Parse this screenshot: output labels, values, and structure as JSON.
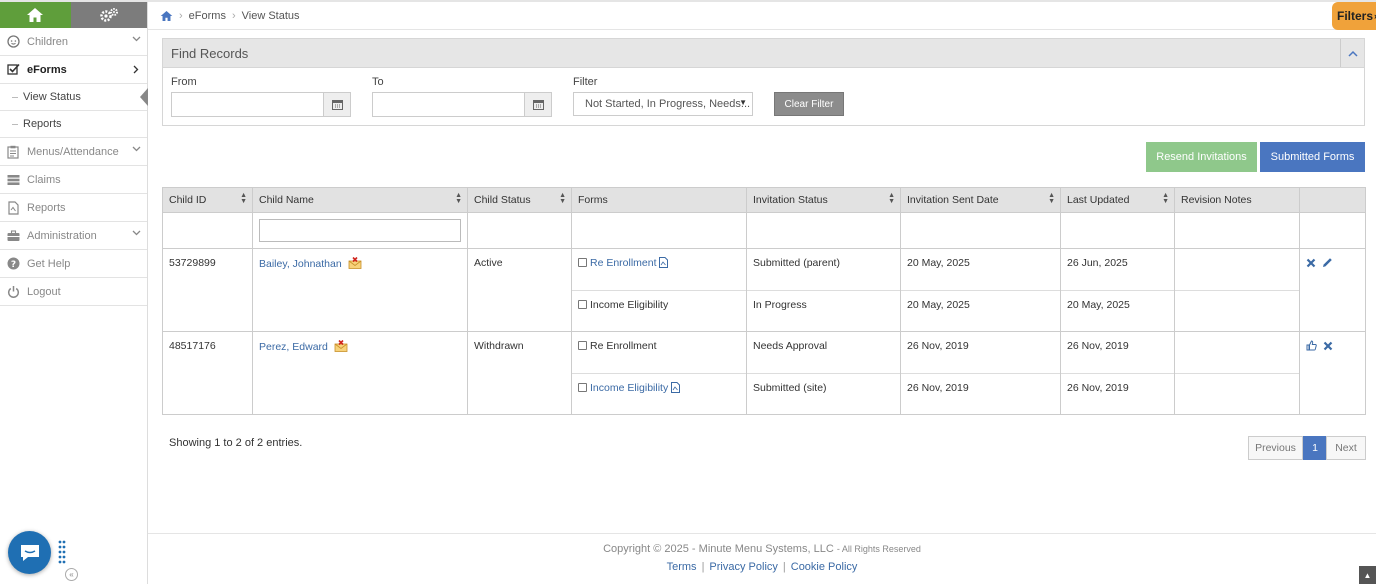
{
  "sidebar": {
    "items": [
      {
        "label": "Children",
        "icon": "child-face-icon"
      },
      {
        "label": "eForms",
        "icon": "checkbox-icon"
      },
      {
        "label": "View Status"
      },
      {
        "label": "Reports"
      },
      {
        "label": "Menus/Attendance",
        "icon": "clipboard-icon"
      },
      {
        "label": "Claims",
        "icon": "claims-icon"
      },
      {
        "label": "Reports",
        "icon": "report-file-icon"
      },
      {
        "label": "Administration",
        "icon": "briefcase-icon"
      },
      {
        "label": "Get Help",
        "icon": "question-icon"
      },
      {
        "label": "Logout",
        "icon": "power-icon"
      }
    ]
  },
  "breadcrumb": [
    "eForms",
    "View Status"
  ],
  "filters_tab": "Filters",
  "find": {
    "title": "Find Records",
    "from_label": "From",
    "to_label": "To",
    "filter_label": "Filter",
    "filter_value": "Not Started, In Progress, Needs...",
    "clear_label": "Clear Filter"
  },
  "actions": {
    "resend": "Resend Invitations",
    "submitted": "Submitted Forms"
  },
  "table": {
    "headers": [
      "Child ID",
      "Child Name",
      "Child Status",
      "Forms",
      "Invitation Status",
      "Invitation Sent Date",
      "Last Updated",
      "Revision Notes"
    ],
    "rows": [
      {
        "id": "53729899",
        "name": "Bailey, Johnathan",
        "status": "Active",
        "forms": [
          {
            "name": "Re Enrollment",
            "inv_status": "Submitted (parent)",
            "sent": "20 May, 2025",
            "updated": "26 Jun, 2025"
          },
          {
            "name": "Income Eligibility",
            "inv_status": "In Progress",
            "sent": "20 May, 2025",
            "updated": "20 May, 2025"
          }
        ]
      },
      {
        "id": "48517176",
        "name": "Perez, Edward",
        "status": "Withdrawn",
        "forms": [
          {
            "name": "Re Enrollment",
            "inv_status": "Needs Approval",
            "sent": "26 Nov, 2019",
            "updated": "26 Nov, 2019"
          },
          {
            "name": "Income Eligibility",
            "inv_status": "Submitted (site)",
            "sent": "26 Nov, 2019",
            "updated": "26 Nov, 2019"
          }
        ]
      }
    ]
  },
  "pagination": {
    "showing": "Showing 1 to 2 of 2 entries.",
    "previous": "Previous",
    "page": "1",
    "next": "Next"
  },
  "footer": {
    "copyright": "Copyright © 2025 - Minute Menu Systems, LLC",
    "rights": "- All Rights Reserved",
    "links": [
      "Terms",
      "Privacy Policy",
      "Cookie Policy"
    ],
    "separator": "|"
  },
  "colors": {
    "accent_green": "#5f9e3b",
    "accent_blue": "#4a76c0",
    "filters_orange": "#f0a23a",
    "link": "#3b6aa5"
  }
}
